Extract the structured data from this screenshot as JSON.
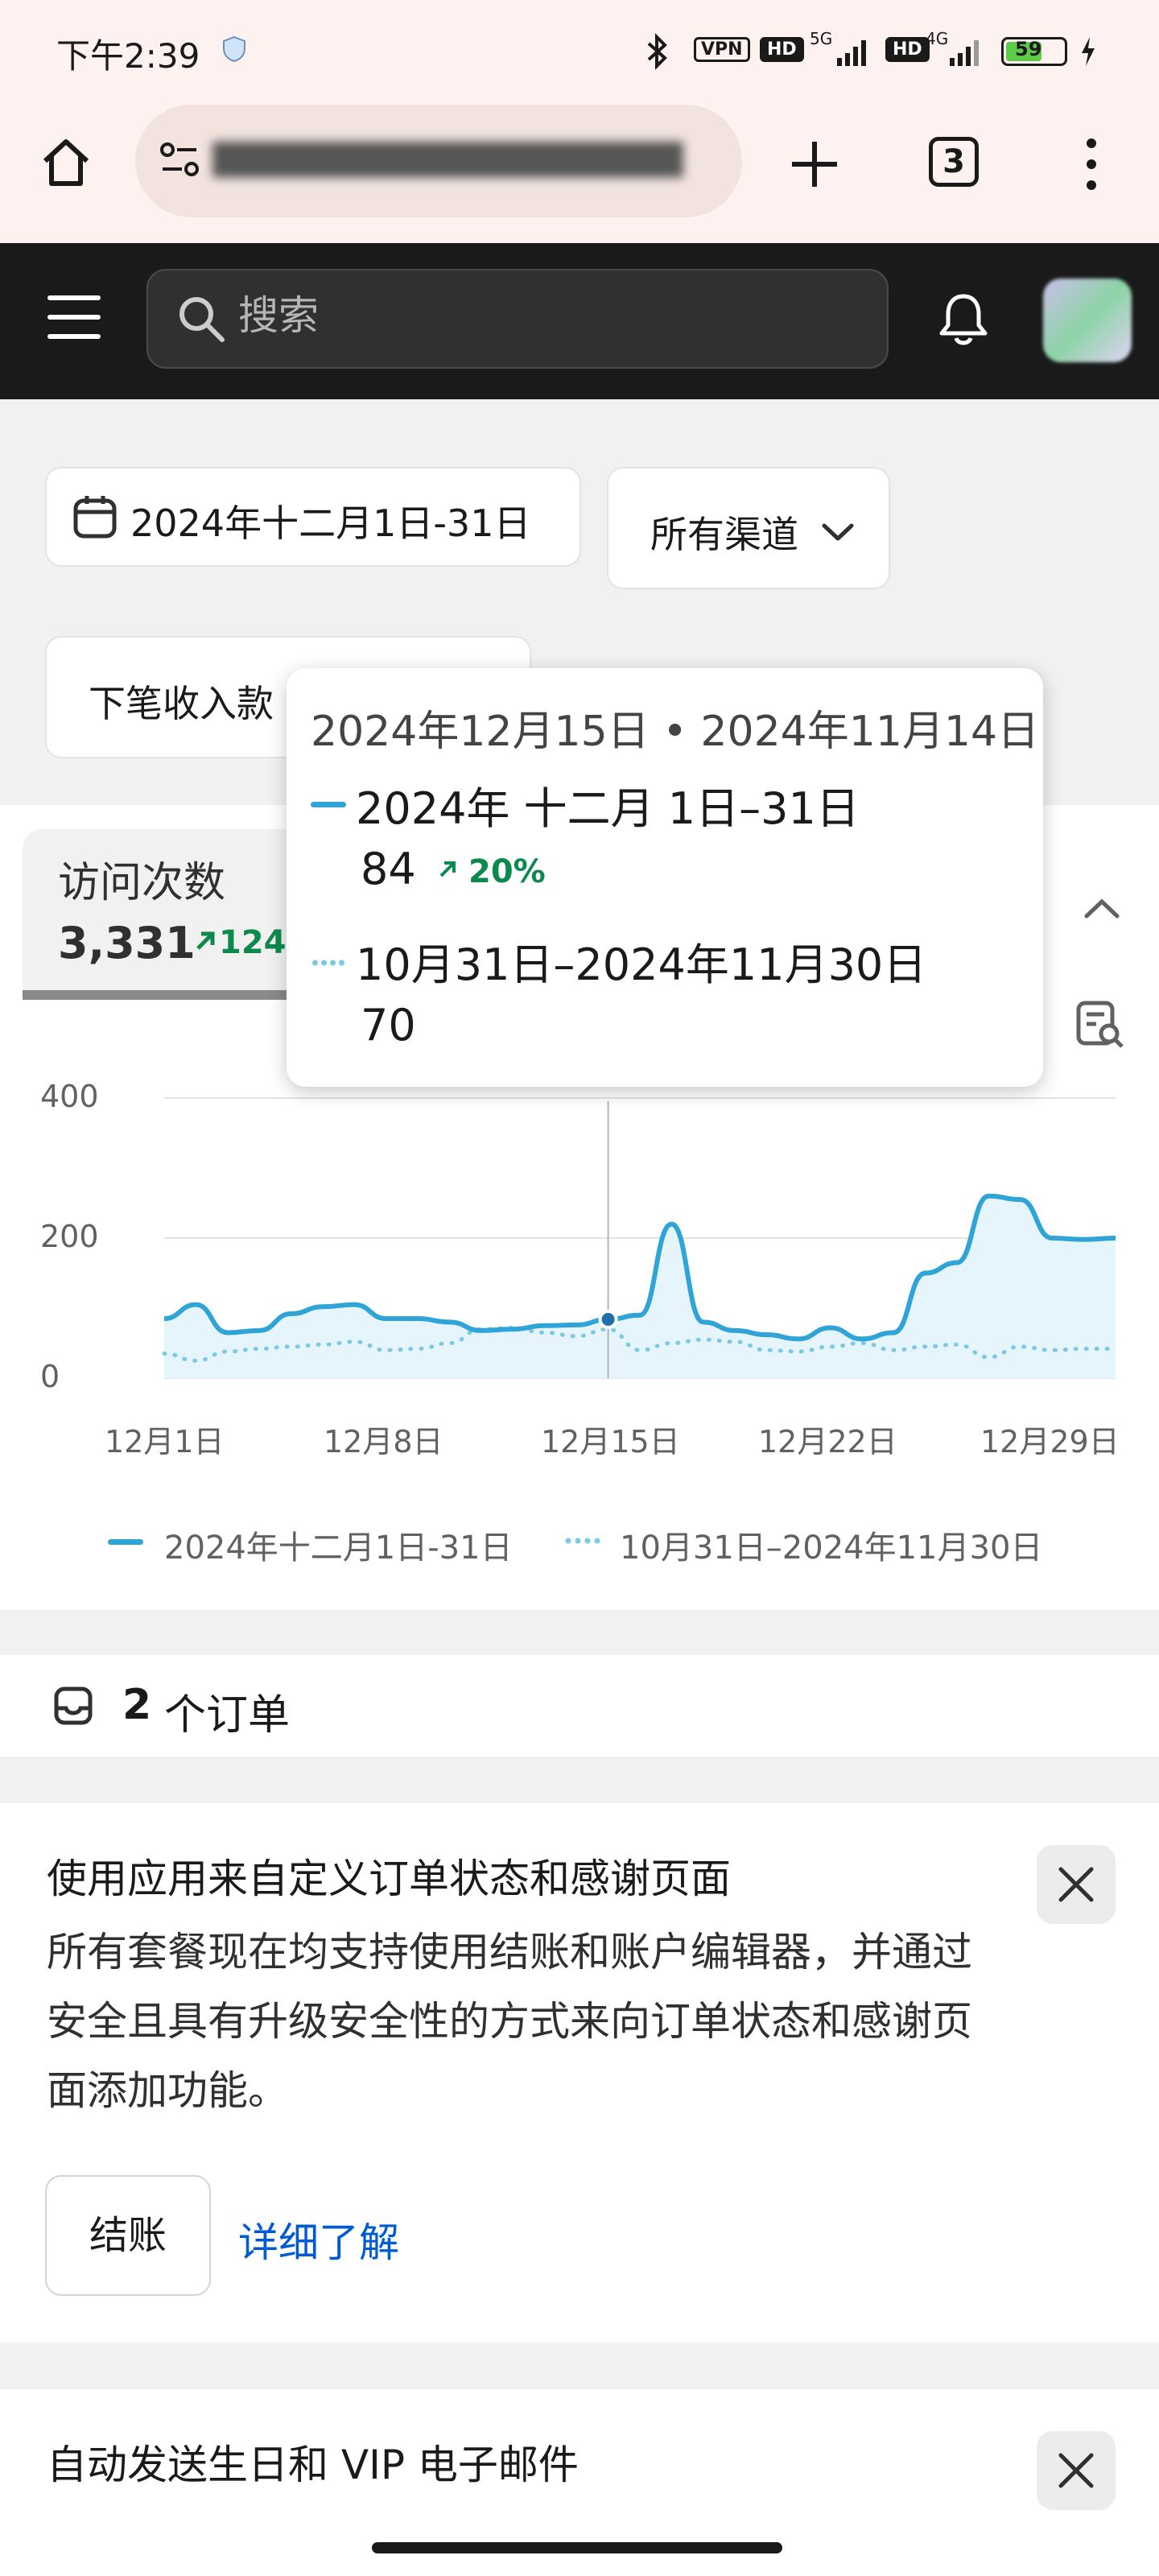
{
  "status_bar": {
    "time": "下午2:39",
    "vpn": "VPN",
    "hd1": "HD",
    "net1": "5G",
    "hd2": "HD",
    "net2": "4G",
    "battery": "59"
  },
  "browser": {
    "tab_count": "3"
  },
  "admin": {
    "search_placeholder": "搜索"
  },
  "filters": {
    "date_range": "2024年十二月1日-31日",
    "channel": "所有渠道",
    "metric_select": "下笔收入款"
  },
  "metric": {
    "label": "访问次数",
    "value": "3,331",
    "delta": "124%"
  },
  "tooltip": {
    "header": "2024年12月15日 • 2024年11月14日",
    "series1_label": "2024年 十二月 1日–31日",
    "series1_value": "84",
    "series1_delta": "20%",
    "series2_label": "10月31日–2024年11月30日",
    "series2_value": "70"
  },
  "chart_data": {
    "type": "area",
    "y_ticks": [
      "400",
      "200",
      "0"
    ],
    "ylim": [
      0,
      400
    ],
    "x_tick_labels": [
      "12月1日",
      "12月8日",
      "12月15日",
      "12月22日",
      "12月29日"
    ],
    "x": [
      1,
      2,
      3,
      4,
      5,
      6,
      7,
      8,
      9,
      10,
      11,
      12,
      13,
      14,
      15,
      16,
      17,
      18,
      19,
      20,
      21,
      22,
      23,
      24,
      25,
      26,
      27,
      28,
      29,
      30,
      31
    ],
    "series": [
      {
        "name": "2024年十二月1日-31日",
        "color": "#2fa4d7",
        "style": "solid",
        "values": [
          85,
          105,
          65,
          68,
          92,
          102,
          105,
          85,
          85,
          80,
          68,
          70,
          75,
          76,
          84,
          90,
          220,
          80,
          68,
          62,
          56,
          72,
          56,
          65,
          150,
          165,
          260,
          255,
          200,
          198,
          200
        ]
      },
      {
        "name": "10月31日–2024年11月30日",
        "color": "#7cc9e4",
        "style": "dotted",
        "values": [
          35,
          25,
          38,
          42,
          45,
          48,
          52,
          40,
          42,
          50,
          70,
          72,
          65,
          60,
          70,
          40,
          50,
          55,
          52,
          40,
          38,
          45,
          50,
          40,
          45,
          48,
          30,
          45,
          40,
          42,
          42
        ]
      }
    ],
    "highlight_x": 15,
    "grid": true,
    "legend_position": "bottom"
  },
  "orders": {
    "count": "2",
    "label": "个订单"
  },
  "promo1": {
    "title": "使用应用来自定义订单状态和感谢页面",
    "line1": "所有套餐现在均支持使用结账和账户编辑器，并通过",
    "line2": "安全且具有升级安全性的方式来向订单状态和感谢页",
    "line3": "面添加功能。",
    "button_label": "结账",
    "link_label": "详细了解"
  },
  "promo2": {
    "title": "自动发送生日和 VIP 电子邮件"
  }
}
